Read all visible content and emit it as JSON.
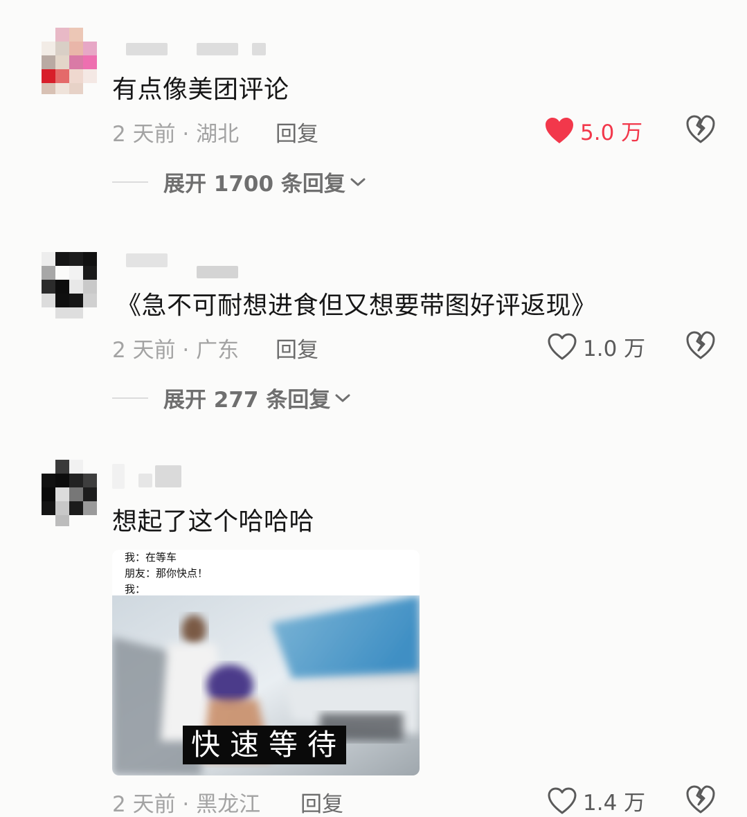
{
  "comments": [
    {
      "text": "有点像美团评论",
      "meta": "2 天前 · 湖北",
      "reply_label": "回复",
      "likes": "5.0 万",
      "liked": true,
      "expand_label": "展开 1700 条回复"
    },
    {
      "text": "《急不可耐想进食但又想要带图好评返现》",
      "meta": "2 天前 · 广东",
      "reply_label": "回复",
      "likes": "1.0 万",
      "liked": false,
      "expand_label": "展开 277 条回复"
    },
    {
      "text": "想起了这个哈哈哈",
      "meta": "2 天前 · 黑龙江",
      "reply_label": "回复",
      "likes": "1.4 万",
      "liked": false,
      "image": {
        "caption_lines": [
          "我：在等车",
          "朋友：那你快点！",
          "我："
        ],
        "subtitle": "快速等待"
      }
    }
  ],
  "colors": {
    "liked": "#f2384b",
    "icon": "#5a5a5a",
    "muted": "#a3a3a3"
  },
  "icons": {
    "like": "heart-icon",
    "dislike": "broken-heart-icon",
    "expand": "chevron-down-icon"
  }
}
